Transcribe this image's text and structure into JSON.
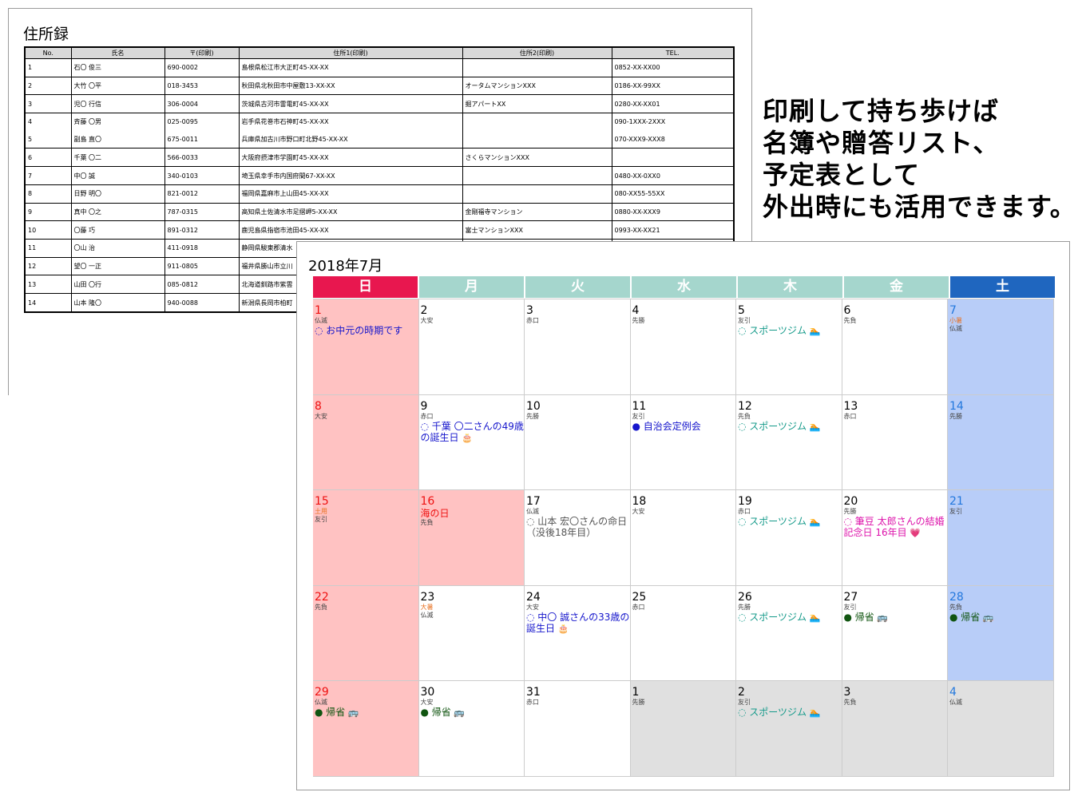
{
  "address_book": {
    "title": "住所録",
    "headers": [
      "No.",
      "氏名",
      "〒(印刷)",
      "住所1(印刷)",
      "住所2(印刷)",
      "TEL."
    ],
    "rows": [
      [
        "1",
        "石〇 俊三",
        "690-0002",
        "島根県松江市大正町45-XX-XX",
        "",
        "0852-XX-XX00"
      ],
      [
        "2",
        "大竹 〇平",
        "018-3453",
        "秋田県北秋田市中屋敷13-XX-XX",
        "オータムマンションXXX",
        "0186-XX-99XX"
      ],
      [
        "3",
        "児〇 行信",
        "306-0004",
        "茨城県古河市雷電町45-XX-XX",
        "掘アパートXX",
        "0280-XX-XX01"
      ],
      [
        "4",
        "斉藤 〇男",
        "025-0095",
        "岩手県花巻市石神町45-XX-XX",
        "",
        "090-1XXX-2XXX"
      ],
      [
        "5",
        "副島 直〇",
        "675-0011",
        "兵庫県加古川市野口町北野45-XX-XX",
        "",
        "070-XXX9-XXX8"
      ],
      [
        "6",
        "千葉 〇二",
        "566-0033",
        "大阪府摂津市学園町45-XX-XX",
        "さくらマンションXXX",
        ""
      ],
      [
        "7",
        "中〇 誠",
        "340-0103",
        "埼玉県幸手市内国府間67-XX-XX",
        "",
        "0480-XX-0XX0"
      ],
      [
        "8",
        "日野 明〇",
        "821-0012",
        "福岡県嘉麻市上山田45-XX-XX",
        "",
        "080-XX55-55XX"
      ],
      [
        "9",
        "真中 〇之",
        "787-0315",
        "高知県土佐清水市足摺岬5-XX-XX",
        "金剛福寺マンション",
        "0880-XX-XXX9"
      ],
      [
        "10",
        "〇藤 巧",
        "891-0312",
        "鹿児島県指宿市池田45-XX-XX",
        "富士マンションXXX",
        "0993-XX-XX21"
      ],
      [
        "11",
        "〇山 治",
        "411-0918",
        "静岡県駿東郡清水",
        "",
        ""
      ],
      [
        "12",
        "望〇 一正",
        "911-0805",
        "福井県勝山市立川",
        "",
        ""
      ],
      [
        "13",
        "山田 〇行",
        "085-0812",
        "北海道釧路市紫雲",
        "",
        ""
      ],
      [
        "14",
        "山本 隆〇",
        "940-0088",
        "新潟県長岡市柏町",
        "",
        ""
      ]
    ]
  },
  "caption": {
    "lines": [
      "印刷して持ち歩けば",
      "名簿や贈答リスト、",
      "予定表として",
      "外出時にも活用できます。"
    ]
  },
  "calendar": {
    "title": "2018年7月",
    "weekdays": [
      "日",
      "月",
      "火",
      "水",
      "木",
      "金",
      "土"
    ],
    "header_colors": [
      "#e8174f",
      "#a5d6cd",
      "#a5d6cd",
      "#a5d6cd",
      "#a5d6cd",
      "#a5d6cd",
      "#1f66bf"
    ],
    "cells": [
      {
        "day": "1",
        "type": "sun",
        "rokuyo": "仏滅",
        "events": [
          {
            "text": "お中元の時期です",
            "color": "blue",
            "mark": "◌",
            "icon": ""
          }
        ]
      },
      {
        "day": "2",
        "type": "",
        "rokuyo": "大安",
        "events": []
      },
      {
        "day": "3",
        "type": "",
        "rokuyo": "赤口",
        "events": []
      },
      {
        "day": "4",
        "type": "",
        "rokuyo": "先勝",
        "events": []
      },
      {
        "day": "5",
        "type": "",
        "rokuyo": "友引",
        "events": [
          {
            "text": "スポーツジム",
            "color": "teal",
            "mark": "◌",
            "icon": "🏊"
          }
        ]
      },
      {
        "day": "6",
        "type": "",
        "rokuyo": "先負",
        "events": []
      },
      {
        "day": "7",
        "type": "sat",
        "season": "小暑",
        "rokuyo": "仏滅",
        "events": []
      },
      {
        "day": "8",
        "type": "sun",
        "rokuyo": "大安",
        "events": []
      },
      {
        "day": "9",
        "type": "",
        "rokuyo": "赤口",
        "events": [
          {
            "text": "千葉 〇二さんの49歳の誕生日",
            "color": "blue",
            "mark": "◌",
            "icon": "🎂"
          }
        ]
      },
      {
        "day": "10",
        "type": "",
        "rokuyo": "先勝",
        "events": []
      },
      {
        "day": "11",
        "type": "",
        "rokuyo": "友引",
        "events": [
          {
            "text": "自治会定例会",
            "color": "blue",
            "mark": "●",
            "icon": ""
          }
        ]
      },
      {
        "day": "12",
        "type": "",
        "rokuyo": "先負",
        "events": [
          {
            "text": "スポーツジム",
            "color": "teal",
            "mark": "◌",
            "icon": "🏊"
          }
        ]
      },
      {
        "day": "13",
        "type": "",
        "rokuyo": "赤口",
        "events": []
      },
      {
        "day": "14",
        "type": "sat",
        "rokuyo": "先勝",
        "events": []
      },
      {
        "day": "15",
        "type": "sun",
        "season": "土用",
        "rokuyo": "友引",
        "events": []
      },
      {
        "day": "16",
        "type": "hol",
        "holiday": "海の日",
        "rokuyo": "先負",
        "events": []
      },
      {
        "day": "17",
        "type": "",
        "rokuyo": "仏滅",
        "events": [
          {
            "text": "山本 宏〇さんの命日（没後18年目）",
            "color": "gray",
            "mark": "◌",
            "icon": ""
          }
        ]
      },
      {
        "day": "18",
        "type": "",
        "rokuyo": "大安",
        "events": []
      },
      {
        "day": "19",
        "type": "",
        "rokuyo": "赤口",
        "events": [
          {
            "text": "スポーツジム",
            "color": "teal",
            "mark": "◌",
            "icon": "🏊"
          }
        ]
      },
      {
        "day": "20",
        "type": "",
        "rokuyo": "先勝",
        "events": [
          {
            "text": "筆豆 太郎さんの結婚記念日 16年目",
            "color": "pink",
            "mark": "◌",
            "icon": "💗"
          }
        ]
      },
      {
        "day": "21",
        "type": "sat",
        "rokuyo": "友引",
        "events": []
      },
      {
        "day": "22",
        "type": "sun",
        "rokuyo": "先負",
        "events": []
      },
      {
        "day": "23",
        "type": "",
        "season": "大暑",
        "rokuyo": "仏滅",
        "events": []
      },
      {
        "day": "24",
        "type": "",
        "rokuyo": "大安",
        "events": [
          {
            "text": "中〇 誠さんの33歳の誕生日",
            "color": "blue",
            "mark": "◌",
            "icon": "🎂"
          }
        ]
      },
      {
        "day": "25",
        "type": "",
        "rokuyo": "赤口",
        "events": []
      },
      {
        "day": "26",
        "type": "",
        "rokuyo": "先勝",
        "events": [
          {
            "text": "スポーツジム",
            "color": "teal",
            "mark": "◌",
            "icon": "🏊"
          }
        ]
      },
      {
        "day": "27",
        "type": "",
        "rokuyo": "友引",
        "events": [
          {
            "text": "帰省",
            "color": "green",
            "mark": "●",
            "icon": "🚌"
          }
        ]
      },
      {
        "day": "28",
        "type": "sat",
        "rokuyo": "先負",
        "events": [
          {
            "text": "帰省",
            "color": "green",
            "mark": "●",
            "icon": "🚌"
          }
        ]
      },
      {
        "day": "29",
        "type": "sun",
        "rokuyo": "仏滅",
        "events": [
          {
            "text": "帰省",
            "color": "green",
            "mark": "●",
            "icon": "🚌"
          }
        ]
      },
      {
        "day": "30",
        "type": "",
        "rokuyo": "大安",
        "events": [
          {
            "text": "帰省",
            "color": "green",
            "mark": "●",
            "icon": "🚌"
          }
        ]
      },
      {
        "day": "31",
        "type": "",
        "rokuyo": "赤口",
        "events": []
      },
      {
        "day": "1",
        "type": "other",
        "rokuyo": "先勝",
        "events": []
      },
      {
        "day": "2",
        "type": "other",
        "rokuyo": "友引",
        "events": [
          {
            "text": "スポーツジム",
            "color": "teal",
            "mark": "◌",
            "icon": "🏊"
          }
        ]
      },
      {
        "day": "3",
        "type": "other",
        "rokuyo": "先負",
        "events": []
      },
      {
        "day": "4",
        "type": "other sat2",
        "rokuyo": "仏滅",
        "events": []
      }
    ]
  }
}
